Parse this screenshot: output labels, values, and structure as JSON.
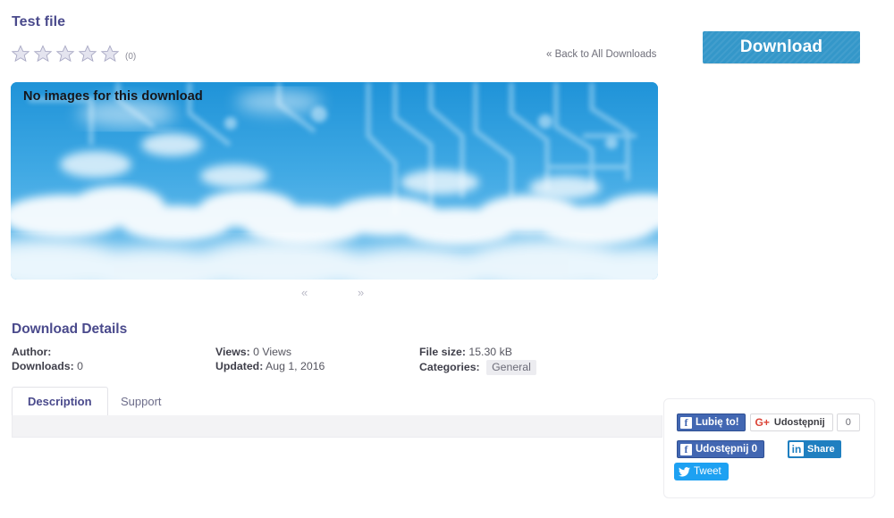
{
  "header": {
    "title": "Test file",
    "rating": {
      "stars_total": 5,
      "stars_filled": 0,
      "count_label": "(0)",
      "star_fill_color": "#e4e4ef",
      "star_stroke_color": "#a9a9c4"
    },
    "back_link": "« Back to All Downloads",
    "download_button": {
      "label": "Download",
      "color": "#3497c9"
    }
  },
  "banner": {
    "caption": "No images for this download",
    "alt_icon": "cloud-circuit-banner"
  },
  "gallery": {
    "prev_label": "«",
    "next_label": "»"
  },
  "details": {
    "heading": "Download Details",
    "columns": [
      {
        "rows": [
          {
            "label": "Author:",
            "value": ""
          },
          {
            "label": "Downloads:",
            "value": "0"
          }
        ]
      },
      {
        "rows": [
          {
            "label": "Views:",
            "value": "0 Views"
          },
          {
            "label": "Updated:",
            "value": "Aug 1, 2016"
          }
        ]
      },
      {
        "rows": [
          {
            "label": "File size:",
            "value": "15.30 kB"
          },
          {
            "label": "Categories:",
            "value": "General",
            "badge": true
          }
        ]
      }
    ]
  },
  "tabs": {
    "active": "Description",
    "items": [
      {
        "label": "Description",
        "active": true
      },
      {
        "label": "Support",
        "active": false
      }
    ],
    "panel_text": ""
  },
  "social": {
    "facebook_like": {
      "label": "Lubię to!",
      "glyph": "f",
      "color": "#4267b2"
    },
    "google_plus": {
      "label": "Udostępnij",
      "glyph": "G+",
      "count": "0",
      "color": "#db4437"
    },
    "facebook_share": {
      "label": "Udostępnij 0",
      "glyph": "f",
      "color": "#4267b2"
    },
    "linkedin": {
      "label": "Share",
      "glyph": "in",
      "color": "#1f7fc0"
    },
    "twitter": {
      "label": "Tweet",
      "glyph": "🐦",
      "color": "#1da1f2"
    }
  }
}
